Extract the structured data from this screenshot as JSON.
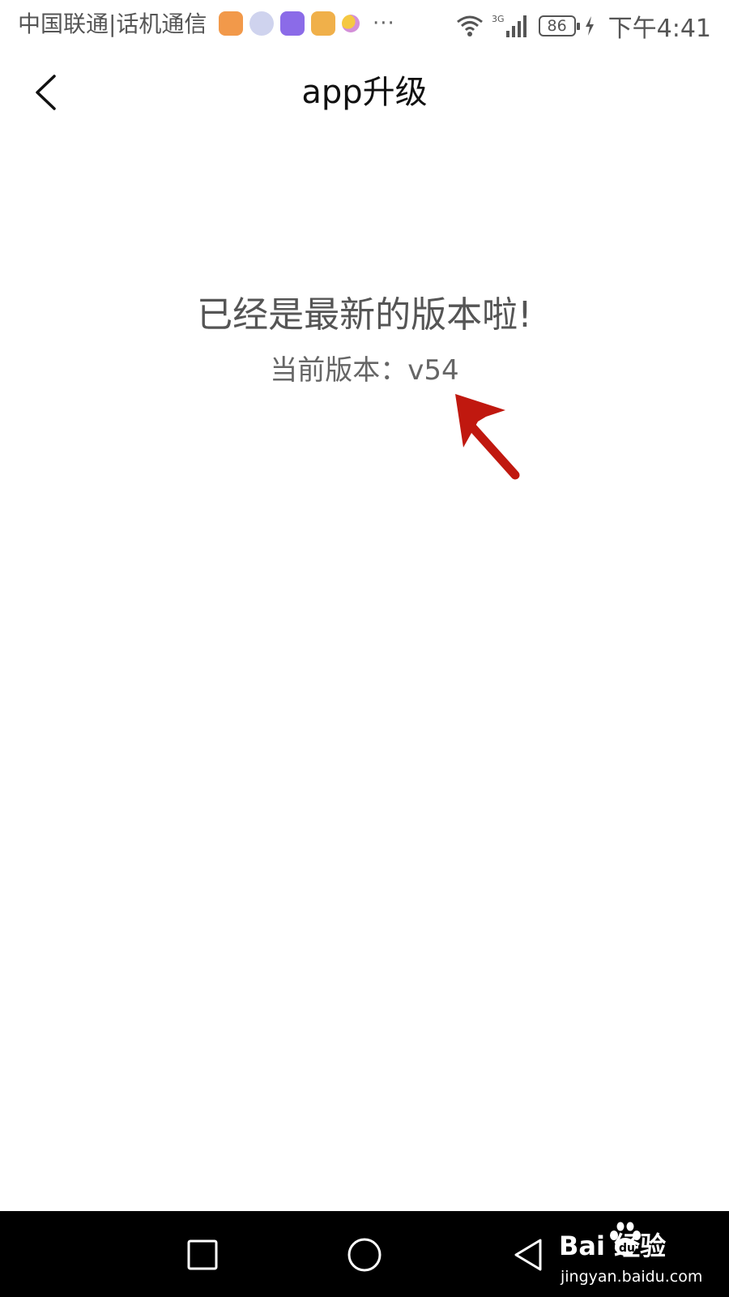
{
  "status_bar": {
    "carrier": "中国联通|话机通信",
    "more": "···",
    "network": "3G",
    "battery": "86",
    "time": "下午4:41"
  },
  "header": {
    "title": "app升级",
    "back_icon": "chevron-left-icon"
  },
  "main": {
    "message": "已经是最新的版本啦!",
    "version_text": "当前版本：v54"
  },
  "annotation": {
    "arrow_color": "#c0180f"
  },
  "nav_bar": {
    "recent_icon": "square-icon",
    "home_icon": "circle-icon",
    "back_icon": "triangle-back-icon"
  },
  "watermark": {
    "brand": "Bai  经验",
    "url": "jingyan.baidu.com"
  }
}
